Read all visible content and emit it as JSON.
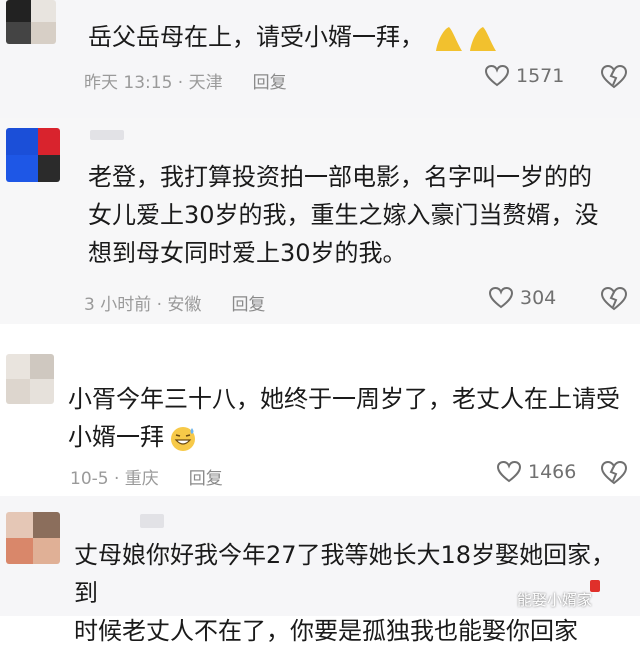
{
  "comments": [
    {
      "text": "岳父岳母在上，请受小婿一拜，",
      "time": "昨天 13:15 · 天津",
      "reply": "回复",
      "likes": "1571",
      "emoji": "pray-hands"
    },
    {
      "text": "老登，我打算投资拍一部电影，名字叫一岁的的\n女儿爱上30岁的我，重生之嫁入豪门当赘婿，没\n想到母女同时爱上30岁的我。",
      "time": "3 小时前 · 安徽",
      "reply": "回复",
      "likes": "304"
    },
    {
      "text": "小胥今年三十八，她终于一周岁了，老丈人在上请受\n小婿一拜",
      "time": "10-5 · 重庆",
      "reply": "回复",
      "likes": "1466",
      "emoji": "grin-sweat"
    },
    {
      "text": "丈母娘你好我今年27了我等她长大18岁娶她回家，到\n时候老丈人不在了，你要是孤独我也能娶你回家",
      "watermark": "能娶小婿家"
    }
  ],
  "colors": {
    "accent_blue": "#1b4fd8",
    "accent_red": "#d9232d",
    "meta_gray": "#9a9a9a"
  }
}
